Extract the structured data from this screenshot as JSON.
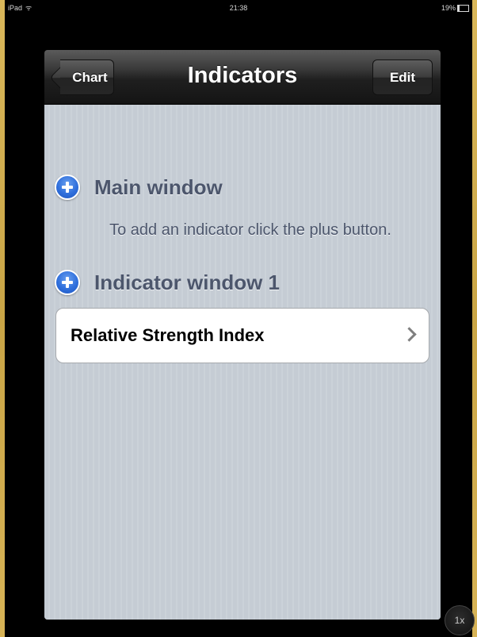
{
  "status_bar": {
    "device": "iPad",
    "wifi_icon": "wifi-icon",
    "time": "21:38",
    "battery_percent_label": "19%",
    "battery_level": 0.19
  },
  "navbar": {
    "title": "Indicators",
    "back_label": "Chart",
    "edit_label": "Edit"
  },
  "sections": [
    {
      "title": "Main window",
      "icon": "add-icon",
      "hint": "To add an indicator click the plus button.",
      "items": []
    },
    {
      "title": "Indicator window 1",
      "icon": "add-icon",
      "items": [
        {
          "label": "Relative Strength Index",
          "accessory": "chevron-right-icon"
        }
      ]
    }
  ],
  "zoom": {
    "label": "1x"
  },
  "colors": {
    "table_background": "#c5ccd4",
    "section_text": "#4c566c",
    "add_icon_blue": "#2f6fdc"
  }
}
